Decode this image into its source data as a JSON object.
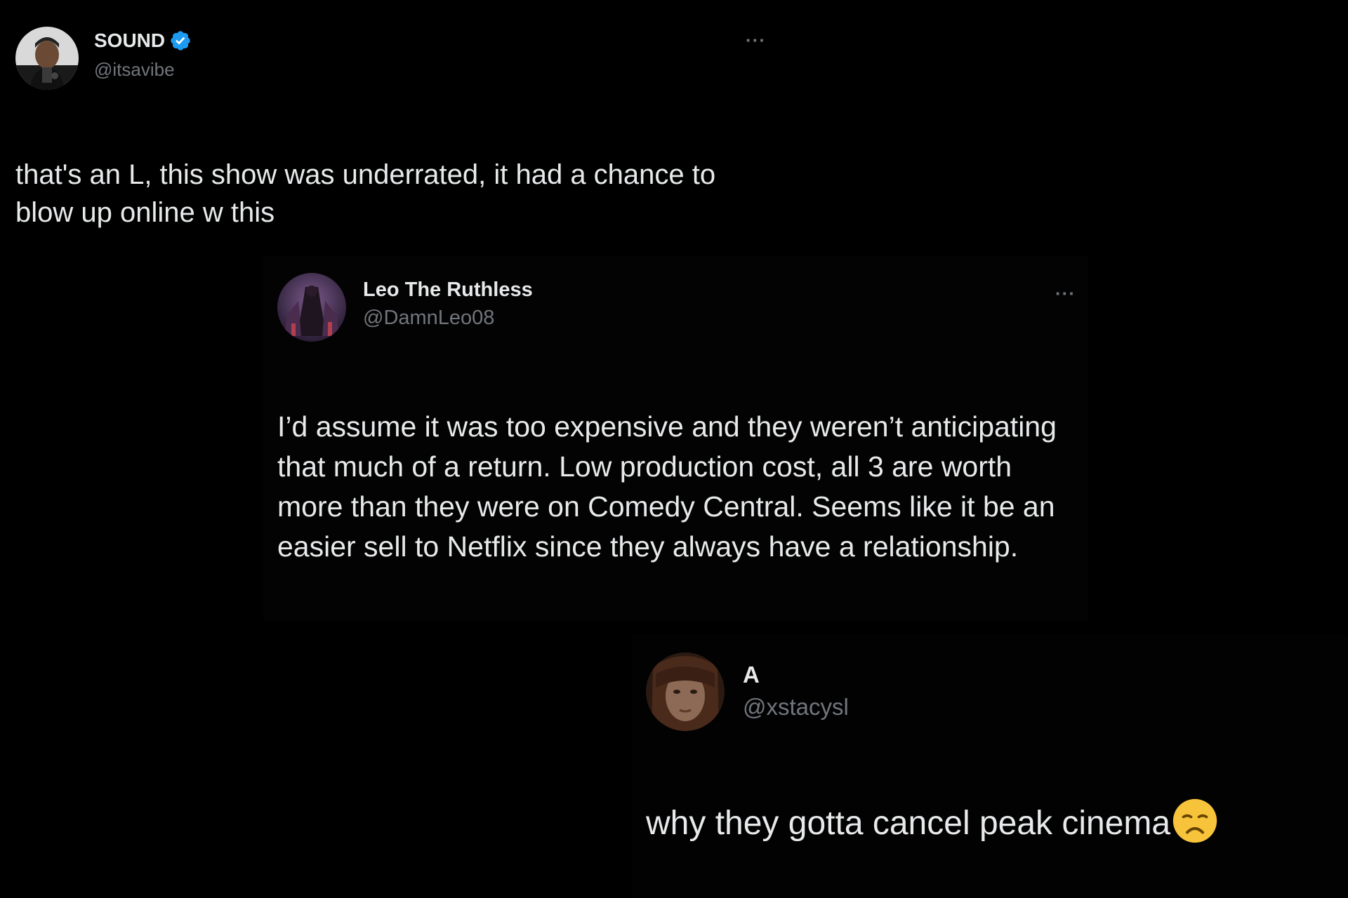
{
  "tweets": [
    {
      "display_name": "SOUND",
      "handle": "@itsavibe",
      "verified": true,
      "avatar_icon": "profile-avatar",
      "more_label": "···",
      "text": "that's an L, this show was underrated, it had a chance to blow up online w this"
    },
    {
      "display_name": "Leo The Ruthless",
      "handle": "@DamnLeo08",
      "verified": false,
      "avatar_icon": "profile-avatar",
      "more_label": "···",
      "text": "I’d assume it was too expensive and they weren’t anticipating that much of a return. Low production cost, all 3 are worth more than they were on Comedy Central. Seems like it be an easier sell to Netflix since they always have a relationship."
    },
    {
      "display_name": "A",
      "handle": "@xstacysl",
      "verified": false,
      "avatar_icon": "profile-avatar",
      "text": "why they gotta cancel peak cinema",
      "emoji": "disappointed-face-emoji"
    }
  ],
  "colors": {
    "background": "#000000",
    "text_primary": "#e7e9ea",
    "text_secondary": "#71767b",
    "verified_blue": "#1d9bf0",
    "emoji_yellow": "#f7c33b"
  }
}
